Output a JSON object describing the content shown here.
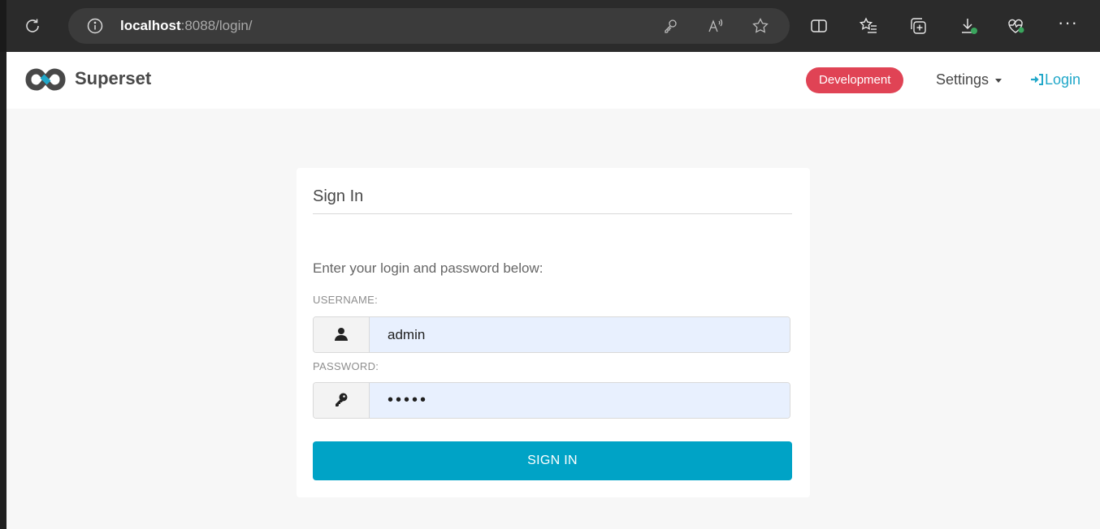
{
  "browser": {
    "url_host": "localhost",
    "url_rest": ":8088/login/"
  },
  "navbar": {
    "brand": "Superset",
    "env_badge": "Development",
    "settings_label": "Settings",
    "login_label": "Login",
    "colors": {
      "badge": "#e04355",
      "link": "#20a7c9"
    }
  },
  "login_card": {
    "title": "Sign In",
    "intro": "Enter your login and password below:",
    "username_label": "USERNAME:",
    "username_value": "admin",
    "password_label": "PASSWORD:",
    "password_value": "•••••",
    "submit_label": "SIGN IN",
    "colors": {
      "button": "#00a3c6",
      "input_bg": "#e8f0fe"
    }
  }
}
